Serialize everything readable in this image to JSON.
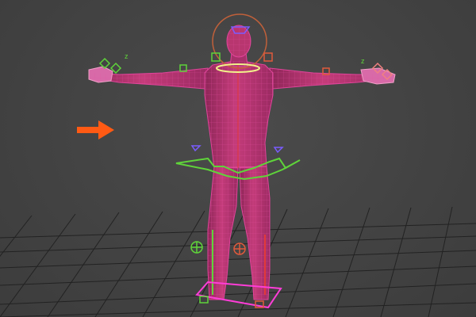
{
  "viewport": {
    "label": "",
    "background": "#444444",
    "grid_color": "#1e1e1e"
  },
  "scene": {
    "mesh": {
      "name": "character-mesh",
      "fill": "#b8366f",
      "wire": "#e0449a",
      "pose": "T-pose"
    },
    "rig_colors": {
      "left_side": "#5fd43a",
      "right_side": "#e05a3c",
      "center": "#f2f28a",
      "selection": "#ff3dd8",
      "accent": "#7a5cff"
    },
    "pointer_arrow": {
      "icon": "arrow-right-icon",
      "color": "#ff5a14"
    },
    "axis_label": "z"
  }
}
